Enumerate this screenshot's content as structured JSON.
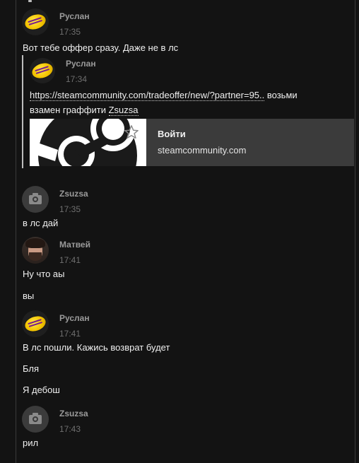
{
  "messages": [
    {
      "author": "Руслан",
      "time": "17:35",
      "lines": [
        "Вот тебе оффер сразу. Даже не в лс"
      ]
    },
    {
      "author": "Zsuzsa",
      "time": "17:35",
      "lines": [
        "в лс дай"
      ]
    },
    {
      "author": "Матвей",
      "time": "17:41",
      "lines": [
        "Ну что аы",
        "вы"
      ]
    },
    {
      "author": "Руслан",
      "time": "17:41",
      "lines": [
        "В лс пошли. Кажись возврат будет",
        "Бля",
        "Я дебош"
      ]
    },
    {
      "author": "Zsuzsa",
      "time": "17:43",
      "lines": [
        "рил"
      ]
    }
  ],
  "quote": {
    "author": "Руслан",
    "time": "17:34",
    "link": "https://steamcommunity.com/tradeoffer/new/?partner=95..",
    "after_link": " возьми",
    "line2_prefix": "взамен граффити ",
    "mention": "Zsuzsa",
    "preview": {
      "title": "Войти",
      "domain": "steamcommunity.com"
    }
  },
  "colors": {
    "background": "#131313",
    "card": "#3b3b3b",
    "author": "#9a9a9a",
    "time": "#6f6f6f"
  },
  "icons": {
    "zsuzsa_avatar": "camera-icon",
    "preview_favorite": "star-outline-icon",
    "preview_logo": "steam-logo"
  }
}
